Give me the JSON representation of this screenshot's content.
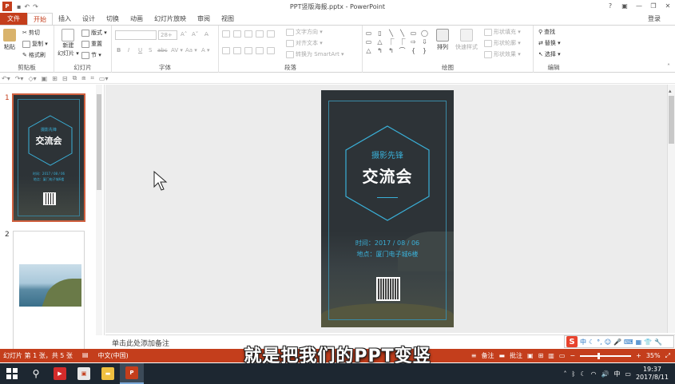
{
  "window": {
    "title": "PPT竖版海报.pptx - PowerPoint",
    "controls": [
      "?",
      "▣",
      "—",
      "❐",
      "✕"
    ]
  },
  "tabs": [
    "文件",
    "开始",
    "插入",
    "设计",
    "切换",
    "动画",
    "幻灯片放映",
    "审阅",
    "视图"
  ],
  "active_tab": "开始",
  "login_label": "登录",
  "ribbon": {
    "clipboard": {
      "label": "剪贴板",
      "paste": "粘贴",
      "cut": "剪切",
      "copy": "复制 ▾",
      "format_painter": "格式刷"
    },
    "slides": {
      "label": "幻灯片",
      "new_slide": "新建",
      "new_slide2": "幻灯片 ▾",
      "layout": "版式 ▾",
      "reset": "重置",
      "section": "节 ▾"
    },
    "font": {
      "label": "字体",
      "size": "28+",
      "b": "B",
      "i": "I",
      "u": "U",
      "s": "S",
      "abc": "abc",
      "av": "AV ▾",
      "aa": "Aa ▾",
      "a": "A ▾",
      "grow": "A˄",
      "shrink": "A˅",
      "clear": "A̶"
    },
    "paragraph": {
      "label": "段落",
      "text_dir": "文字方向 ▾",
      "align_text": "对齐文本 ▾",
      "smartart": "转换为 SmartArt ▾"
    },
    "drawing": {
      "label": "绘图",
      "arrange": "排列",
      "quick_styles": "快速样式",
      "fill": "形状填充 ▾",
      "outline": "形状轮廓 ▾",
      "effects": "形状效果 ▾"
    },
    "editing": {
      "label": "编辑",
      "find": "查找",
      "replace": "替换 ▾",
      "select": "选择 ▾"
    }
  },
  "shapes_gallery": [
    "▭",
    "▯",
    "╲",
    "╲",
    "▭",
    "◯",
    "▭",
    "△",
    "⎾",
    "⎾",
    "⇨",
    "⇩",
    "△",
    "↰",
    "↰",
    "⌒",
    "{",
    "}"
  ],
  "slides": [
    {
      "num": "1",
      "title_small": "摄影先锋",
      "title": "交流会",
      "time": "时间：2017 / 08 / 06",
      "place": "地点：厦门电子城6楼"
    },
    {
      "num": "2"
    }
  ],
  "notes_placeholder": "单击此处添加备注",
  "status": {
    "slide_info": "幻灯片 第 1 张，共 5 张",
    "language": "中文(中国)",
    "notes": "备注",
    "comments": "批注",
    "zoom": "35%"
  },
  "ime": {
    "logo": "S",
    "mode": "中"
  },
  "subtitle": "就是把我们的PPT变竖",
  "taskbar": {
    "tray_lang": "中",
    "time": "19:37",
    "date": "2017/8/11"
  },
  "colors": {
    "accent": "#c43e1c",
    "slide_bg": "#2d3337",
    "slide_cyan": "#3ab0d8"
  }
}
